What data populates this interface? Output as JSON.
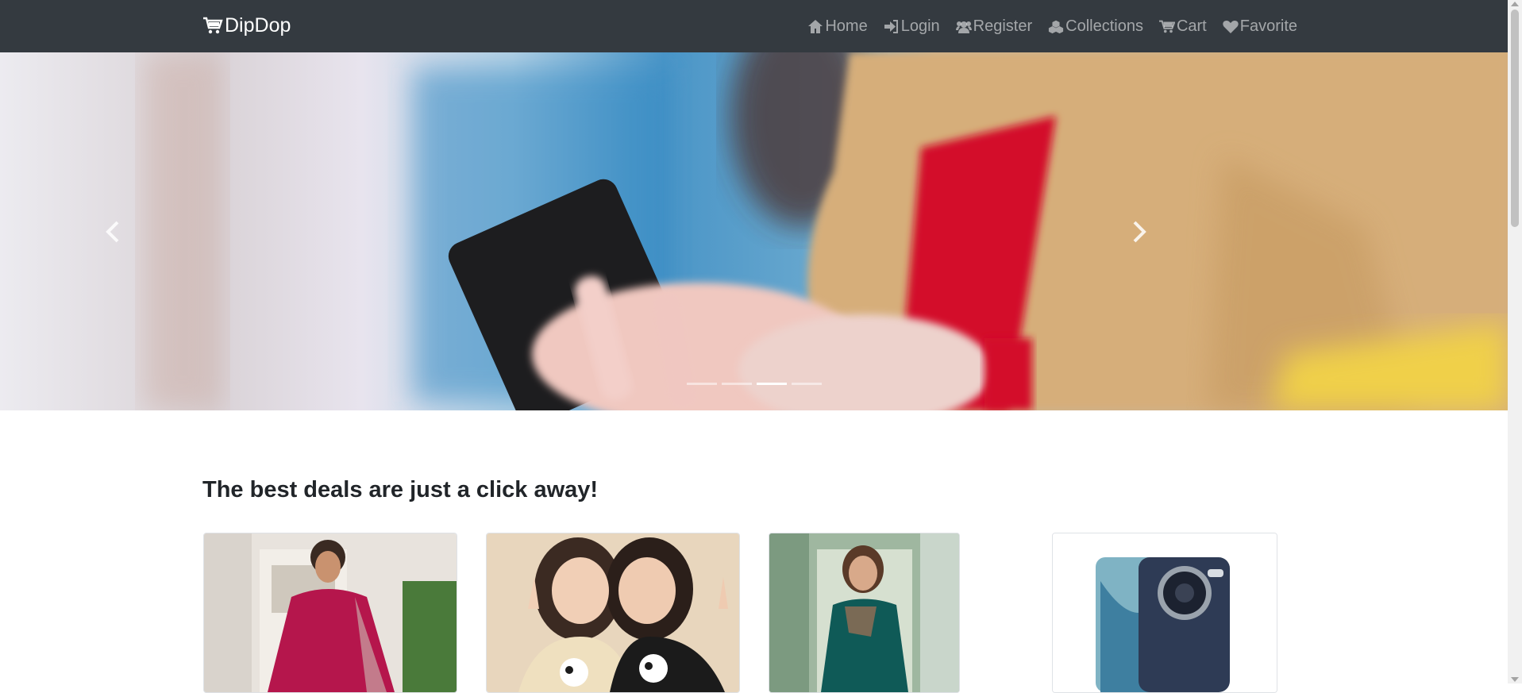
{
  "navbar": {
    "brand": "DipDop",
    "brand_icon": "cart-icon",
    "links": [
      {
        "label": "Home",
        "icon": "home-icon"
      },
      {
        "label": "Login",
        "icon": "login-icon"
      },
      {
        "label": "Register",
        "icon": "users-icon"
      },
      {
        "label": "Collections",
        "icon": "cubes-icon"
      },
      {
        "label": "Cart",
        "icon": "cart-icon"
      },
      {
        "label": "Favorite",
        "icon": "heart-icon"
      }
    ]
  },
  "carousel": {
    "slide_count": 4,
    "active_index": 2
  },
  "section": {
    "title": "The best deals are just a click away!"
  },
  "products": [
    {
      "icon": "product-image"
    },
    {
      "icon": "product-image"
    },
    {
      "icon": "product-image"
    },
    {
      "icon": "product-image"
    }
  ],
  "colors": {
    "navbar_bg": "#343a40",
    "nav_text": "#9a9da0",
    "brand_text": "#ffffff"
  }
}
